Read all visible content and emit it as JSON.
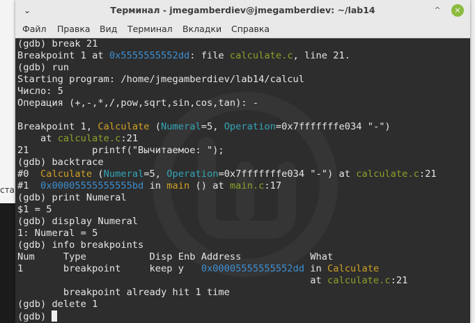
{
  "window": {
    "title": "Терминал - jmegamberdiev@jmegamberdiev: ~/lab14",
    "minimize_glyph": "⌄",
    "maximize_glyph": "^",
    "close_glyph": "×",
    "close_color": "#8cbb3f"
  },
  "menu": {
    "items": [
      "Файл",
      "Правка",
      "Вид",
      "Терминал",
      "Вкладки",
      "Справка"
    ]
  },
  "background": {
    "left_fragment": "ста"
  },
  "terminal": {
    "colors": {
      "text": "#e6e6e6",
      "background": "#2d2d2d",
      "address": "#3d8fd1",
      "file": "#8aa22c",
      "function": "#cfa124",
      "param": "#33a6b8"
    },
    "lines": [
      [
        {
          "t": "(gdb) break 21"
        }
      ],
      [
        {
          "t": "Breakpoint 1 at "
        },
        {
          "t": "0x5555555552dd",
          "c": "addr"
        },
        {
          "t": ": file "
        },
        {
          "t": "calculate.c",
          "c": "file"
        },
        {
          "t": ", line 21."
        }
      ],
      [
        {
          "t": "(gdb) run"
        }
      ],
      [
        {
          "t": "Starting program: /home/jmegamberdiev/lab14/calcul"
        }
      ],
      [
        {
          "t": "Число: 5"
        }
      ],
      [
        {
          "t": "Операция (+,-,*,/,pow,sqrt,sin,cos,tan): -"
        }
      ],
      [
        {
          "t": ""
        }
      ],
      [
        {
          "t": "Breakpoint 1, "
        },
        {
          "t": "Calculate",
          "c": "func"
        },
        {
          "t": " ("
        },
        {
          "t": "Numeral",
          "c": "par"
        },
        {
          "t": "=5, "
        },
        {
          "t": "Operation",
          "c": "par"
        },
        {
          "t": "=0x7fffffffe034 \"-\")"
        }
      ],
      [
        {
          "t": "    at "
        },
        {
          "t": "calculate.c",
          "c": "file"
        },
        {
          "t": ":21"
        }
      ],
      [
        {
          "t": "21           printf(\"Вычитаемое: \");"
        }
      ],
      [
        {
          "t": "(gdb) backtrace"
        }
      ],
      [
        {
          "t": "#0  "
        },
        {
          "t": "Calculate",
          "c": "func"
        },
        {
          "t": " ("
        },
        {
          "t": "Numeral",
          "c": "par"
        },
        {
          "t": "=5, "
        },
        {
          "t": "Operation",
          "c": "par"
        },
        {
          "t": "=0x7fffffffe034 \"-\") at "
        },
        {
          "t": "calculate.c",
          "c": "file"
        },
        {
          "t": ":21"
        }
      ],
      [
        {
          "t": "#1  "
        },
        {
          "t": "0x00005555555555bd",
          "c": "addr"
        },
        {
          "t": " in "
        },
        {
          "t": "main",
          "c": "func"
        },
        {
          "t": " () at "
        },
        {
          "t": "main.c",
          "c": "file"
        },
        {
          "t": ":17"
        }
      ],
      [
        {
          "t": "(gdb) print Numeral"
        }
      ],
      [
        {
          "t": "$1 = 5"
        }
      ],
      [
        {
          "t": "(gdb) display Numeral"
        }
      ],
      [
        {
          "t": "1: Numeral = 5"
        }
      ],
      [
        {
          "t": "(gdb) info breakpoints"
        }
      ],
      [
        {
          "t": "Num     Type           Disp Enb Address            What"
        }
      ],
      [
        {
          "t": "1       breakpoint     keep y   "
        },
        {
          "t": "0x00005555555552dd",
          "c": "addr"
        },
        {
          "t": " in "
        },
        {
          "t": "Calculate",
          "c": "func"
        }
      ],
      [
        {
          "t": "                                                   at "
        },
        {
          "t": "calculate.c",
          "c": "file"
        },
        {
          "t": ":21"
        }
      ],
      [
        {
          "t": "        breakpoint already hit 1 time"
        }
      ],
      [
        {
          "t": "(gdb) delete 1"
        }
      ],
      [
        {
          "t": "(gdb) "
        },
        {
          "t": "",
          "c": "cursor"
        }
      ]
    ]
  }
}
